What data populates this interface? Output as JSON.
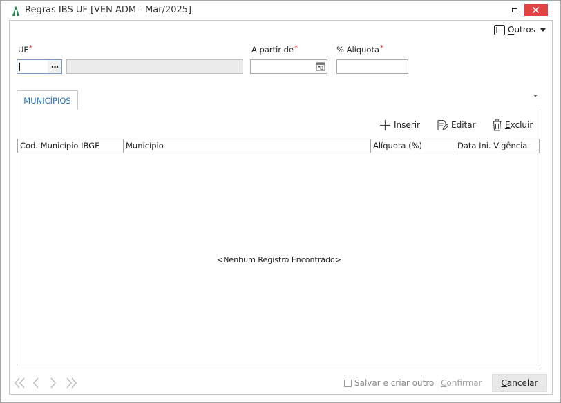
{
  "window": {
    "title": "Regras IBS UF [VEN ADM - Mar/2025]"
  },
  "toolbar": {
    "outros_label": "Outros"
  },
  "form": {
    "uf_label": "UF",
    "uf_value": "",
    "uf_lookup_button": "...",
    "uf_description": "",
    "a_partir_de_label": "A partir de",
    "a_partir_de_value": "",
    "aliquota_label": "% Alíquota",
    "aliquota_value": "",
    "required_marker": "*"
  },
  "tabs": [
    {
      "label": "MUNICÍPIOS",
      "active": true
    }
  ],
  "grid_actions": {
    "insert_label": "Inserir",
    "edit_label": "Editar",
    "delete_label": "Excluir"
  },
  "grid": {
    "columns": [
      "Cod. Município IBGE",
      "Município",
      "Alíquota (%)",
      "Data Ini. Vigência"
    ],
    "rows": [],
    "empty_message": "<Nenhum Registro Encontrado>"
  },
  "footer": {
    "save_and_create_label": "Salvar e criar outro",
    "save_and_create_checked": false,
    "confirm_label": "Confirmar",
    "cancel_label": "Cancelar"
  },
  "colors": {
    "tab_accent": "#1f6fb5",
    "close_button": "#e04343",
    "required_marker": "#dd1111",
    "app_icon": "#2e8b57"
  }
}
